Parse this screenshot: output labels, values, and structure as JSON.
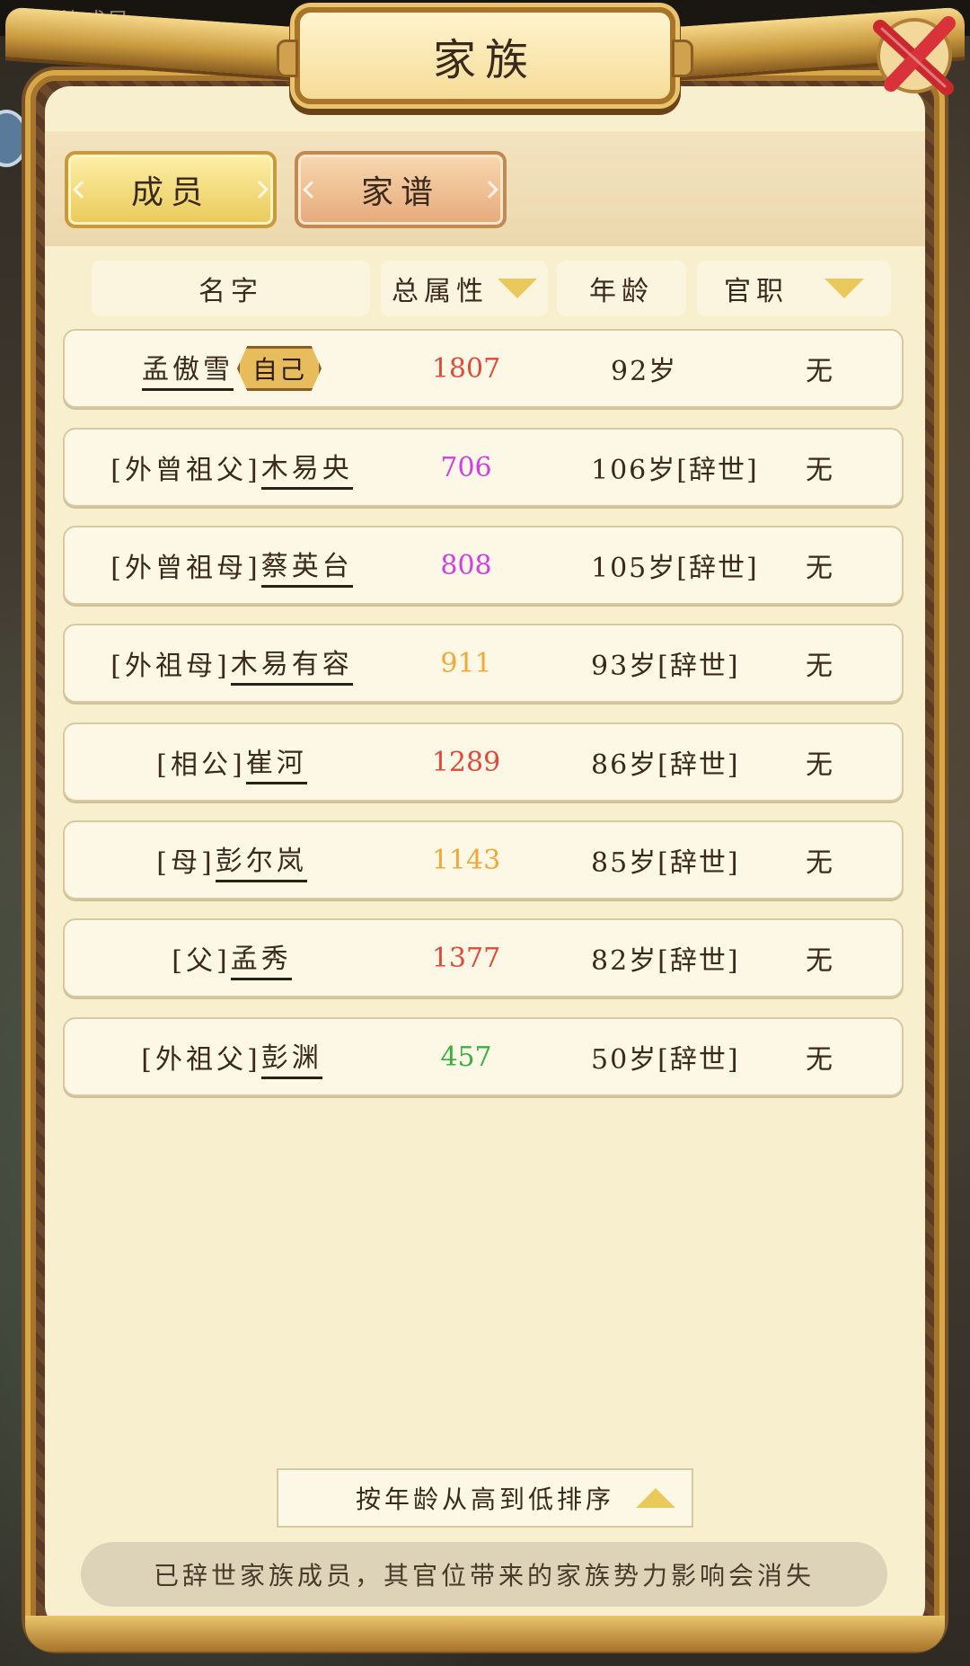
{
  "background": {
    "top_text": "家族成员"
  },
  "header": {
    "title": "家族",
    "close_label": "关闭"
  },
  "tabs": [
    {
      "label": "成员",
      "active": true
    },
    {
      "label": "家谱",
      "active": false
    }
  ],
  "columns": {
    "name": "名字",
    "attr": "总属性",
    "age": "年龄",
    "title": "官职"
  },
  "rows": [
    {
      "relation": "",
      "name": "孟傲雪",
      "badge": "自己",
      "attr": "1807",
      "attr_color": "#e04a3a",
      "age": "92岁",
      "title": "无"
    },
    {
      "relation": "[外曾祖父]",
      "name": "木易央",
      "badge": "",
      "attr": "706",
      "attr_color": "#d040e0",
      "age": "106岁[辞世]",
      "title": "无"
    },
    {
      "relation": "[外曾祖母]",
      "name": "蔡英台",
      "badge": "",
      "attr": "808",
      "attr_color": "#d040e0",
      "age": "105岁[辞世]",
      "title": "无"
    },
    {
      "relation": "[外祖母]",
      "name": "木易有容",
      "badge": "",
      "attr": "911",
      "attr_color": "#f0a838",
      "age": "93岁[辞世]",
      "title": "无"
    },
    {
      "relation": "[相公]",
      "name": "崔河",
      "badge": "",
      "attr": "1289",
      "attr_color": "#e04a3a",
      "age": "86岁[辞世]",
      "title": "无"
    },
    {
      "relation": "[母]",
      "name": "彭尔岚",
      "badge": "",
      "attr": "1143",
      "attr_color": "#f0a838",
      "age": "85岁[辞世]",
      "title": "无"
    },
    {
      "relation": "[父]",
      "name": "孟秀",
      "badge": "",
      "attr": "1377",
      "attr_color": "#e04a3a",
      "age": "82岁[辞世]",
      "title": "无"
    },
    {
      "relation": "[外祖父]",
      "name": "彭渊",
      "badge": "",
      "attr": "457",
      "attr_color": "#3ab040",
      "age": "50岁[辞世]",
      "title": "无"
    }
  ],
  "sort": {
    "label": "按年龄从高到低排序"
  },
  "notice": "已辞世家族成员，其官位带来的家族势力影响会消失",
  "colors": {
    "accent_gold": "#e9c95a",
    "frame_gold": "#d8a848",
    "panel": "#f8efcf"
  },
  "icons": {
    "close": "red-x-close-icon",
    "sort_dropdown": "triangle-down-icon",
    "sort_order": "triangle-up-icon"
  }
}
